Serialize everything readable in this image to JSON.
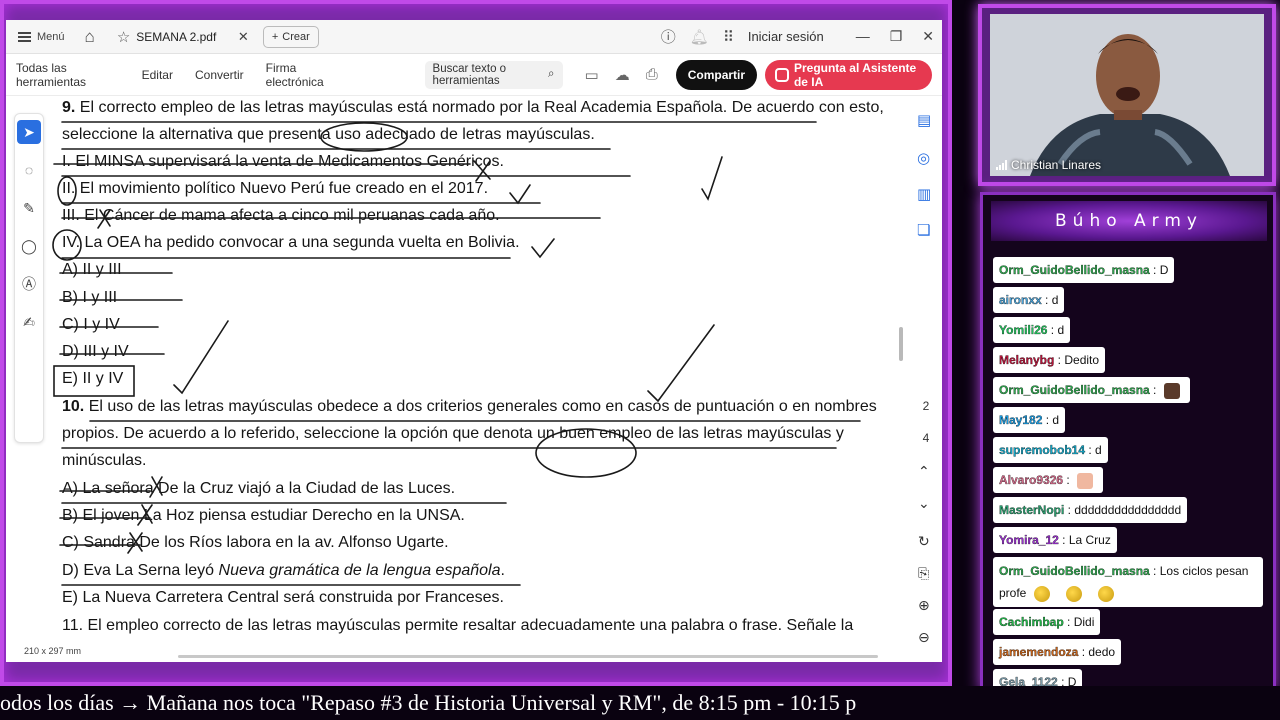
{
  "app": {
    "menu_label": "Menú",
    "tab_title": "SEMANA 2.pdf",
    "create_label": "Crear",
    "signin_label": "Iniciar sesión",
    "toolbar": {
      "all_tools": "Todas las herramientas",
      "edit": "Editar",
      "convert": "Convertir",
      "esign": "Firma electrónica",
      "search_placeholder": "Buscar texto o herramientas",
      "share": "Compartir",
      "ai_assistant": "Pregunta al Asistente de IA"
    },
    "page_numbers": [
      "2",
      "4"
    ],
    "page_size_label": "210 x 297 mm"
  },
  "document": {
    "q9": {
      "number": "9.",
      "stem_line1": "El correcto empleo de las letras mayúsculas está normado por la Real Academia Española. De acuerdo con esto,",
      "stem_line2": "seleccione la alternativa que presenta uso adecuado de letras mayúsculas.",
      "statements": [
        "I. El MINSA supervisará la venta de Medicamentos Genéricos.",
        "II. El movimiento político Nuevo Perú fue creado en el 2017.",
        "III. El Cáncer de mama afecta a cinco mil peruanas cada año.",
        "IV. La OEA ha pedido convocar a una segunda vuelta en Bolivia."
      ],
      "options": [
        "A) II y III",
        "B) I y III",
        "C) I y IV",
        "D) III y IV",
        "E) II y IV"
      ]
    },
    "q10": {
      "number": "10.",
      "stem_line1": "El uso de las letras mayúsculas obedece a dos criterios generales como en casos de puntuación o en nombres",
      "stem_line2": "propios. De acuerdo a lo referido, seleccione la opción que denota un buen empleo de las letras mayúsculas y",
      "stem_line3": "minúsculas.",
      "options": [
        "A) La señora De la Cruz viajó a la Ciudad de las Luces.",
        "B) El joven La Hoz piensa estudiar Derecho en la UNSA.",
        "C) Sandra De los Ríos labora en la av. Alfonso Ugarte.",
        "E) La Nueva Carretera Central será construida por Franceses."
      ],
      "option_d_prefix": "D) Eva La Serna leyó ",
      "option_d_title": "Nueva gramática de la lengua española",
      "option_d_suffix": "."
    },
    "q11_partial": "11. El empleo correcto de las letras mayúsculas permite resaltar adecuadamente una palabra o frase. Señale la"
  },
  "webcam": {
    "name": "Christian Linares"
  },
  "chat": {
    "title": "Búho Army",
    "messages": [
      {
        "user": "Orm_GuidoBellido_masna",
        "text": "D",
        "color": "#2fa84f"
      },
      {
        "user": "aironxx",
        "text": "d",
        "color": "#4aa3d8"
      },
      {
        "user": "Yomili26",
        "text": "d",
        "color": "#22c55e"
      },
      {
        "user": "Melanybg",
        "text": "Dedito",
        "color": "#b8143a"
      },
      {
        "user": "Orm_GuidoBellido_masna",
        "text": "",
        "color": "#2fa84f"
      },
      {
        "user": "May182",
        "text": "d",
        "color": "#1a9be0"
      },
      {
        "user": "supremobob14",
        "text": "d",
        "color": "#14a8c8"
      },
      {
        "user": "Alvaro9326",
        "text": "",
        "color": "#d46a8a"
      },
      {
        "user": "MasterNopi",
        "text": "dddddddddddddddd",
        "color": "#2aa070"
      },
      {
        "user": "Yomira_12",
        "text": "La Cruz",
        "color": "#9b30d0"
      },
      {
        "user": "Orm_GuidoBellido_masna",
        "text": "Los ciclos pesan profe",
        "color": "#2fa84f"
      },
      {
        "user": "Cachimbap",
        "text": "Didi",
        "color": "#22b84a"
      },
      {
        "user": "jamemendoza",
        "text": "dedo",
        "color": "#c8641a"
      },
      {
        "user": "Gela_1122",
        "text": "D",
        "color": "#7a9aa8"
      }
    ]
  },
  "ticker": {
    "text": "odos los días  →  Mañana nos toca \"Repaso #3 de Historia Universal y RM\", de 8:15 pm - 10:15 p"
  },
  "colors": {
    "frame": "#c04ae8",
    "share_button": "#111111",
    "ai_button": "#e63950",
    "active_tool": "#2a6fe0"
  }
}
